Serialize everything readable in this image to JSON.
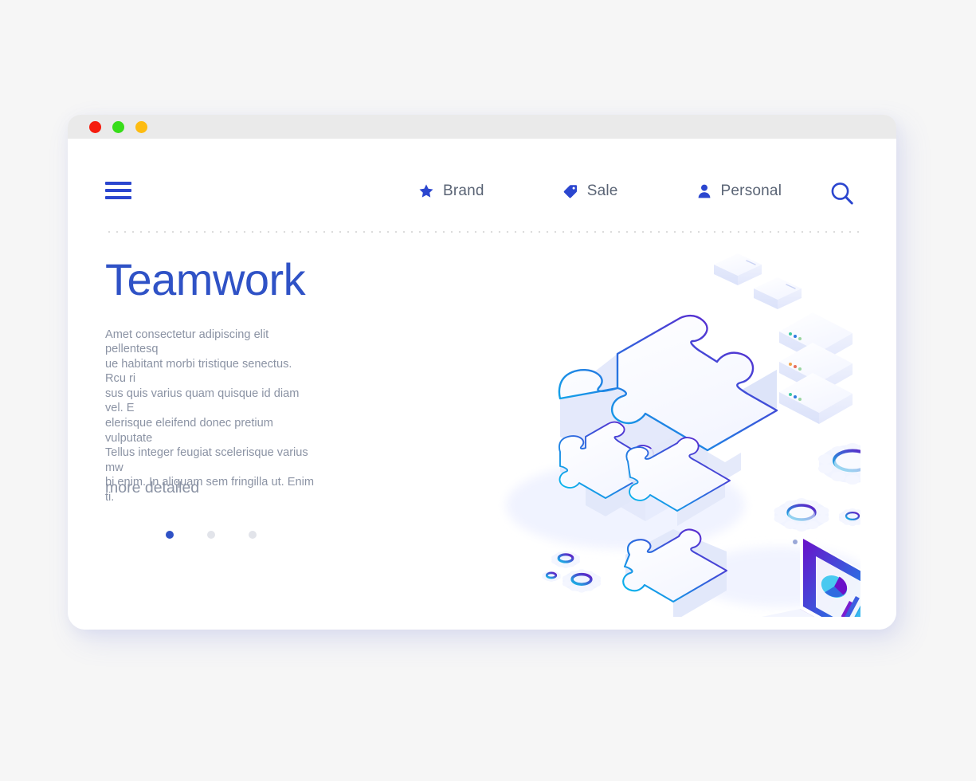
{
  "window": {
    "traffic_lights": [
      {
        "name": "close",
        "color": "#f51c0e"
      },
      {
        "name": "minimize",
        "color": "#38dd1a"
      },
      {
        "name": "maximize",
        "color": "#fdbc12"
      }
    ]
  },
  "nav": {
    "menu_icon": "hamburger-icon",
    "items": [
      {
        "icon": "star-icon",
        "label": "Brand"
      },
      {
        "icon": "tag-icon",
        "label": "Sale"
      },
      {
        "icon": "person-icon",
        "label": "Personal"
      }
    ],
    "search_icon": "search-icon"
  },
  "hero": {
    "headline": "Teamwork",
    "body": "Amet consectetur adipiscing elit pellentesq\nue habitant morbi tristique senectus. Rcu ri\nsus quis varius quam quisque id diam vel. E\nelerisque eleifend donec pretium vulputate\nTellus integer feugiat scelerisque varius mw\nbi enim. In aliquam sem fringilla ut. Enim ti.",
    "carousel": {
      "count": 3,
      "active_index": 0
    },
    "cta_label": "more detailed"
  },
  "illustration": {
    "name": "isometric-teamwork-puzzle-scene",
    "elements": [
      "large-puzzle-piece",
      "small-puzzle-piece-left",
      "small-puzzle-piece-center",
      "small-puzzle-piece-right",
      "laptop-with-charts",
      "server-stack",
      "floating-card-top",
      "floating-card-bottom",
      "gear-large",
      "gear-medium",
      "gear-small",
      "gear-cluster-bottom-left",
      "document-sheet"
    ]
  },
  "colors": {
    "background": "#f6f6f6",
    "accent_blue": "#2f52c6",
    "nav_text": "#5a6475",
    "body_text": "#8b93a4",
    "gradient_start": "#00c2f0",
    "gradient_end": "#6a11c9"
  }
}
